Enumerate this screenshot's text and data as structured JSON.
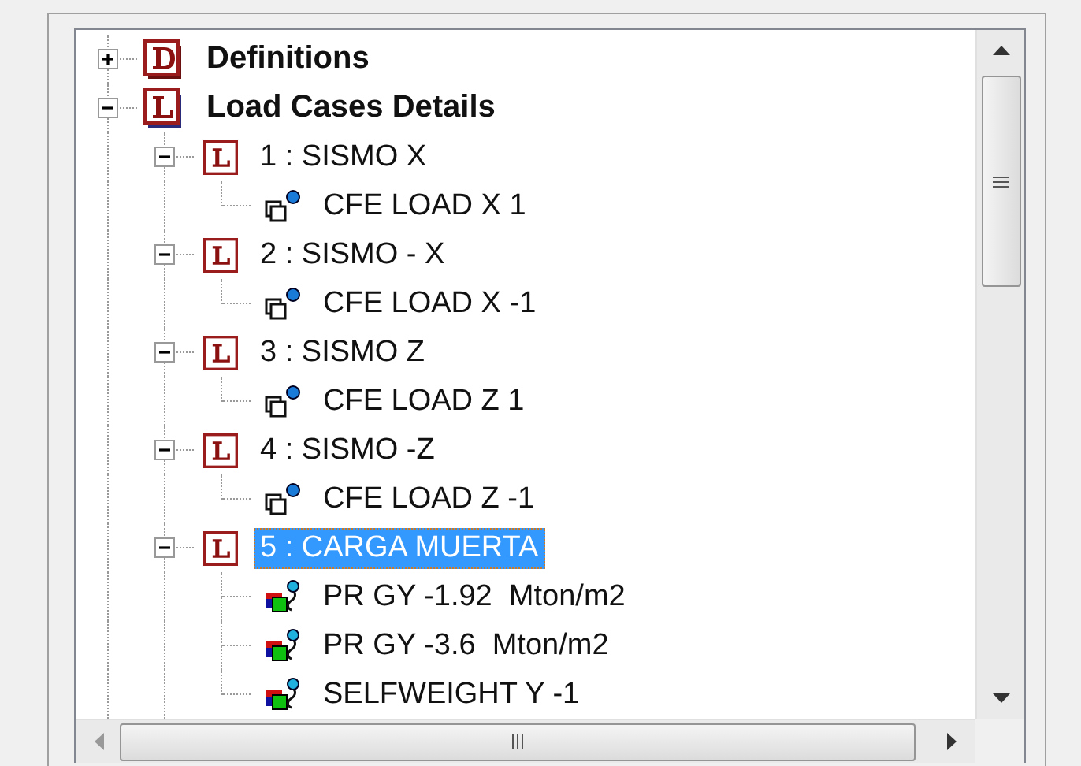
{
  "tree": [
    {
      "label": "Definitions",
      "kind": "definitions",
      "expanded": false,
      "selected": false
    },
    {
      "label": "Load Cases Details",
      "kind": "load-group",
      "expanded": true,
      "selected": false,
      "children": [
        {
          "label": "1 : SISMO X",
          "kind": "load-case",
          "expanded": true,
          "selected": false,
          "children": [
            {
              "label": "CFE LOAD X 1",
              "kind": "seismic-load",
              "selected": false
            }
          ]
        },
        {
          "label": "2 : SISMO - X",
          "kind": "load-case",
          "expanded": true,
          "selected": false,
          "children": [
            {
              "label": "CFE LOAD X -1",
              "kind": "seismic-load",
              "selected": false
            }
          ]
        },
        {
          "label": "3 : SISMO Z",
          "kind": "load-case",
          "expanded": true,
          "selected": false,
          "children": [
            {
              "label": "CFE LOAD Z 1",
              "kind": "seismic-load",
              "selected": false
            }
          ]
        },
        {
          "label": "4 : SISMO -Z",
          "kind": "load-case",
          "expanded": true,
          "selected": false,
          "children": [
            {
              "label": "CFE LOAD Z -1",
              "kind": "seismic-load",
              "selected": false
            }
          ]
        },
        {
          "label": "5 : CARGA MUERTA",
          "kind": "load-case",
          "expanded": true,
          "selected": true,
          "children": [
            {
              "label": "PR GY -1.92  Mton/m2",
              "kind": "pressure-load",
              "selected": false
            },
            {
              "label": "PR GY -3.6  Mton/m2",
              "kind": "pressure-load",
              "selected": false
            },
            {
              "label": "SELFWEIGHT Y -1",
              "kind": "pressure-load",
              "selected": false
            }
          ]
        }
      ]
    }
  ]
}
